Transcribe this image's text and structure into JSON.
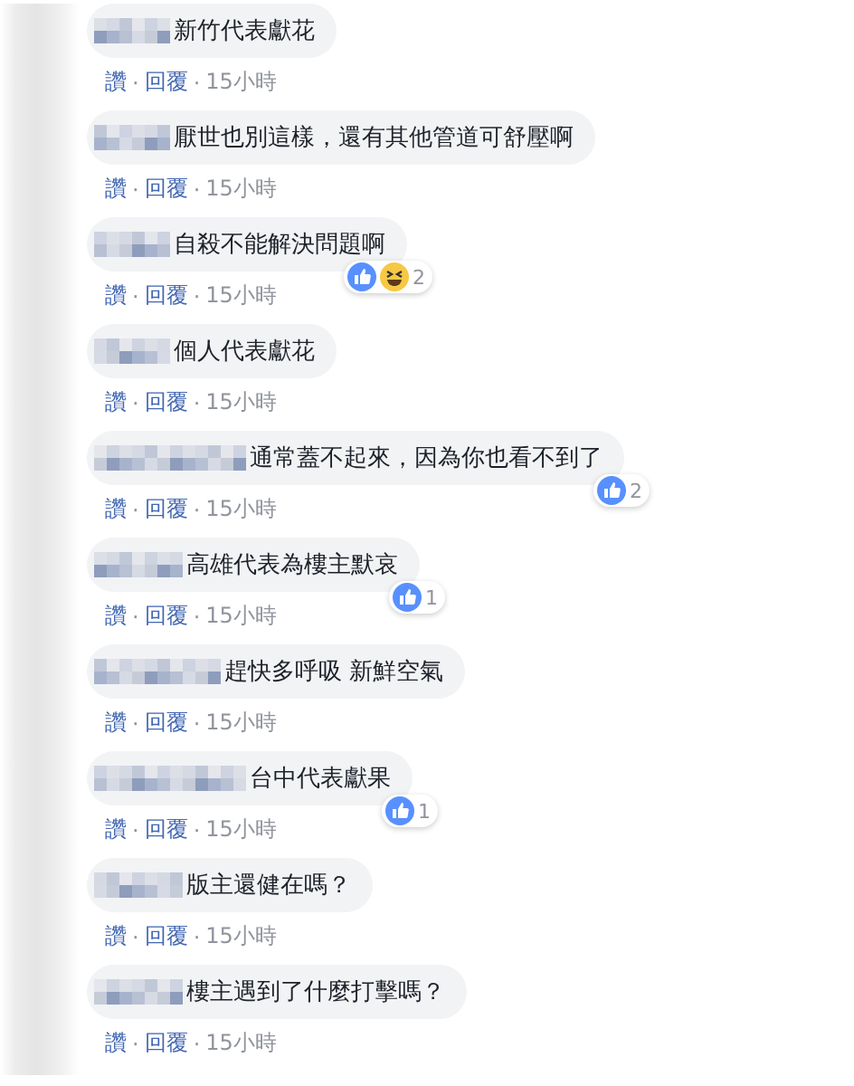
{
  "comments": [
    {
      "text": "新竹代表獻花",
      "actions": [
        {
          "kind": "link",
          "label": "讚"
        },
        {
          "kind": "sep",
          "label": "·"
        },
        {
          "kind": "link",
          "label": "回覆"
        },
        {
          "kind": "sep",
          "label": "·"
        },
        {
          "kind": "time",
          "label": "15小時"
        }
      ]
    },
    {
      "text": "厭世也別這樣，還有其他管道可舒壓啊",
      "actions": [
        {
          "kind": "link",
          "label": "讚"
        },
        {
          "kind": "sep",
          "label": "·"
        },
        {
          "kind": "link",
          "label": "回覆"
        },
        {
          "kind": "sep",
          "label": "·"
        },
        {
          "kind": "time",
          "label": "15小時"
        }
      ]
    },
    {
      "text": "自殺不能解決問題啊",
      "reactions": [
        {
          "kind": "like"
        },
        {
          "kind": "haha"
        }
      ],
      "reaction_count": "2",
      "actions": [
        {
          "kind": "link",
          "label": "讚"
        },
        {
          "kind": "sep",
          "label": "·"
        },
        {
          "kind": "link",
          "label": "回覆"
        },
        {
          "kind": "sep",
          "label": "·"
        },
        {
          "kind": "time",
          "label": "15小時"
        }
      ]
    },
    {
      "text": "個人代表獻花",
      "actions": [
        {
          "kind": "link",
          "label": "讚"
        },
        {
          "kind": "sep",
          "label": "·"
        },
        {
          "kind": "link",
          "label": "回覆"
        },
        {
          "kind": "sep",
          "label": "·"
        },
        {
          "kind": "time",
          "label": "15小時"
        }
      ]
    },
    {
      "text": "通常蓋不起來，因為你也看不到了",
      "reactions": [
        {
          "kind": "like"
        }
      ],
      "reaction_count": "2",
      "actions": [
        {
          "kind": "link",
          "label": "讚"
        },
        {
          "kind": "sep",
          "label": "·"
        },
        {
          "kind": "link",
          "label": "回覆"
        },
        {
          "kind": "sep",
          "label": "·"
        },
        {
          "kind": "time",
          "label": "15小時"
        }
      ]
    },
    {
      "text": "高雄代表為樓主默哀",
      "reactions": [
        {
          "kind": "like"
        }
      ],
      "reaction_count": "1",
      "actions": [
        {
          "kind": "link",
          "label": "讚"
        },
        {
          "kind": "sep",
          "label": "·"
        },
        {
          "kind": "link",
          "label": "回覆"
        },
        {
          "kind": "sep",
          "label": "·"
        },
        {
          "kind": "time",
          "label": "15小時"
        }
      ]
    },
    {
      "text": "趕快多呼吸 新鮮空氣",
      "actions": [
        {
          "kind": "link",
          "label": "讚"
        },
        {
          "kind": "sep",
          "label": "·"
        },
        {
          "kind": "link",
          "label": "回覆"
        },
        {
          "kind": "sep",
          "label": "·"
        },
        {
          "kind": "time",
          "label": "15小時"
        }
      ]
    },
    {
      "text": "台中代表獻果",
      "reactions": [
        {
          "kind": "like"
        }
      ],
      "reaction_count": "1",
      "actions": [
        {
          "kind": "link",
          "label": "讚"
        },
        {
          "kind": "sep",
          "label": "·"
        },
        {
          "kind": "link",
          "label": "回覆"
        },
        {
          "kind": "sep",
          "label": "·"
        },
        {
          "kind": "time",
          "label": "15小時"
        }
      ]
    },
    {
      "text": "版主還健在嗎？",
      "actions": [
        {
          "kind": "link",
          "label": "讚"
        },
        {
          "kind": "sep",
          "label": "·"
        },
        {
          "kind": "link",
          "label": "回覆"
        },
        {
          "kind": "sep",
          "label": "·"
        },
        {
          "kind": "time",
          "label": "15小時"
        }
      ]
    },
    {
      "text": "樓主遇到了什麼打擊嗎？",
      "actions": [
        {
          "kind": "link",
          "label": "讚"
        },
        {
          "kind": "sep",
          "label": "·"
        },
        {
          "kind": "link",
          "label": "回覆"
        },
        {
          "kind": "sep",
          "label": "·"
        },
        {
          "kind": "time",
          "label": "15小時"
        }
      ]
    }
  ]
}
